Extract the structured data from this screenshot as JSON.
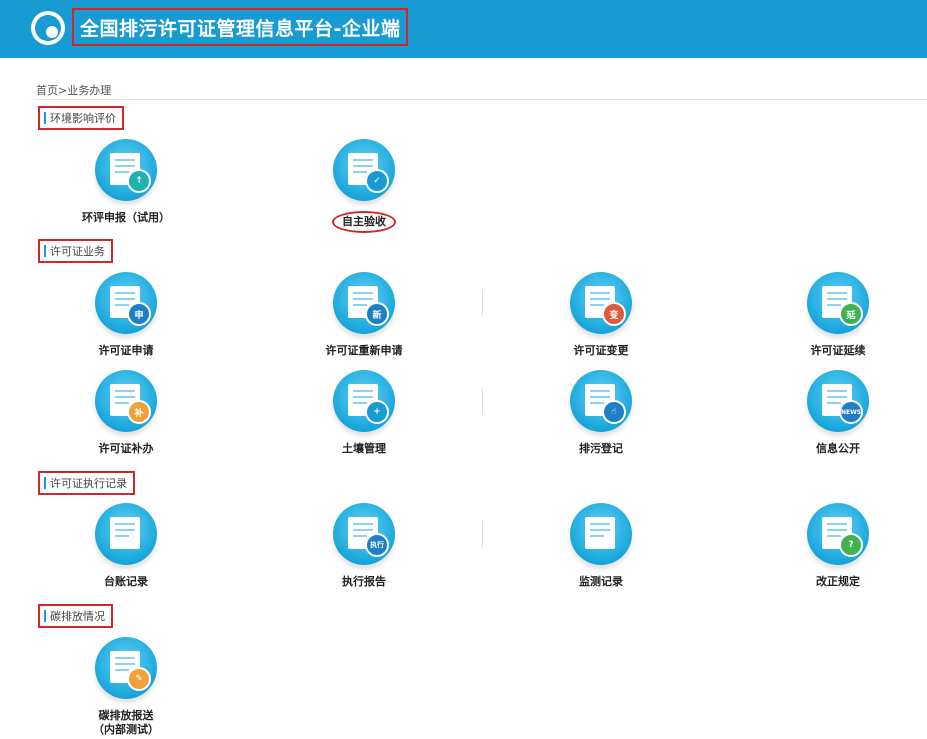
{
  "header": {
    "title": "全国排污许可证管理信息平台-企业端"
  },
  "breadcrumb": "首页>业务办理",
  "sections": {
    "eia": {
      "title": "环境影响评价"
    },
    "permit": {
      "title": "许可证业务"
    },
    "exec": {
      "title": "许可证执行记录"
    },
    "carbon": {
      "title": "碳排放情况"
    }
  },
  "tiles": {
    "eia_report": {
      "label": "环评申报（试用）",
      "badge": "↑"
    },
    "self_accept": {
      "label": "自主验收",
      "badge": "✓"
    },
    "permit_apply": {
      "label": "许可证申请",
      "badge": "申"
    },
    "permit_renew": {
      "label": "许可证重新申请",
      "badge": "新"
    },
    "permit_change": {
      "label": "许可证变更",
      "badge": "变"
    },
    "permit_extend": {
      "label": "许可证延续",
      "badge": "延"
    },
    "permit_reissue": {
      "label": "许可证补办",
      "badge": "补"
    },
    "soil": {
      "label": "土壤管理",
      "badge": "+"
    },
    "pollution_reg": {
      "label": "排污登记",
      "badge": "☝"
    },
    "info_public": {
      "label": "信息公开",
      "badge": "NEWS"
    },
    "ledger": {
      "label": "台账记录",
      "badge": ""
    },
    "exec_report": {
      "label": "执行报告",
      "badge": "执行"
    },
    "monitor": {
      "label": "监测记录",
      "badge": ""
    },
    "rectify": {
      "label": "改正规定",
      "badge": "?"
    },
    "carbon_report": {
      "label": "碳排放报送",
      "label2": "（内部测试）",
      "badge": "✎"
    }
  },
  "colors": {
    "header": "#189ad3",
    "highlight": "#d2262b",
    "green": "#3fb34f",
    "orange": "#f0a13a",
    "red": "#e05a3e"
  }
}
